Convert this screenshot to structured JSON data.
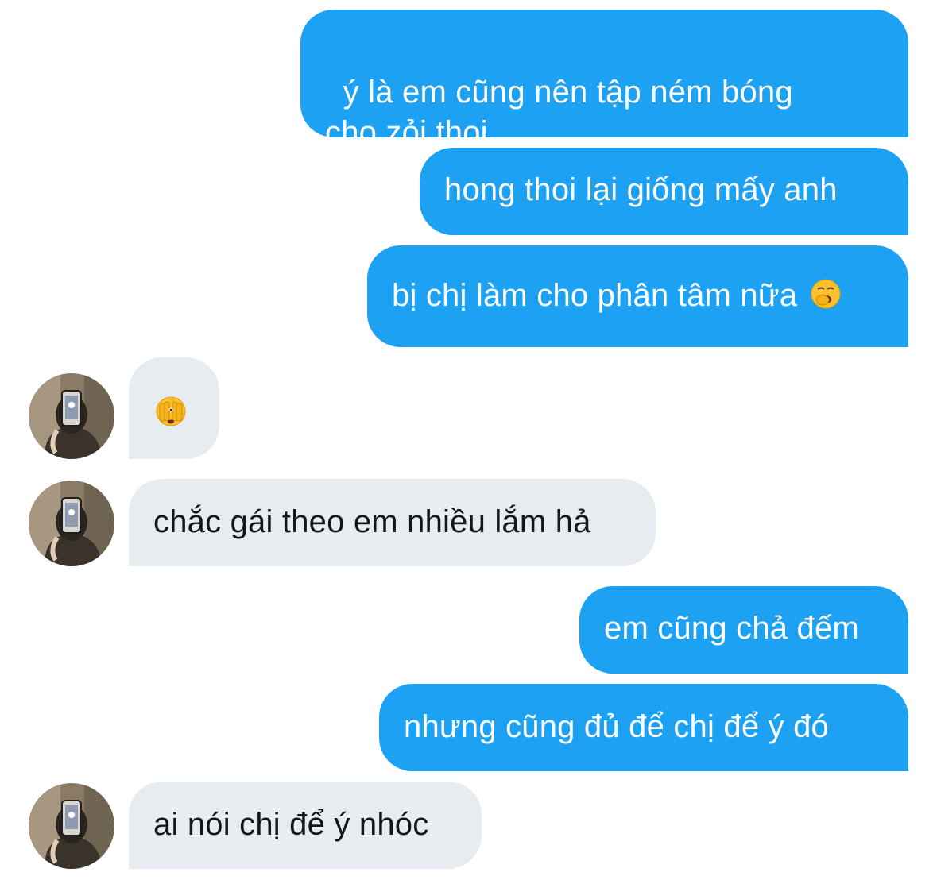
{
  "conversation": {
    "messages": [
      {
        "sender": "me",
        "text": "ý là em cũng nên tập ném bóng\ncho zỏi thoi"
      },
      {
        "sender": "me",
        "text": "hong thoi lại giống mấy anh"
      },
      {
        "sender": "me",
        "text": "bị chị làm cho phân tâm nữa",
        "emoji": "yawning-face-emoji"
      },
      {
        "sender": "other",
        "text": "",
        "emoji": "face-with-peeking-eye-emoji"
      },
      {
        "sender": "other",
        "text": "chắc gái theo em nhiều lắm hả"
      },
      {
        "sender": "me",
        "text": "em cũng chả đếm"
      },
      {
        "sender": "me",
        "text": "nhưng cũng đủ để chị để ý đó"
      },
      {
        "sender": "other",
        "text": "ai nói chị để ý nhóc"
      }
    ]
  },
  "colors": {
    "outgoing_bubble": "#1da1f2",
    "incoming_bubble": "#e6ecf0",
    "outgoing_text": "#ffffff",
    "incoming_text": "#14171a"
  }
}
